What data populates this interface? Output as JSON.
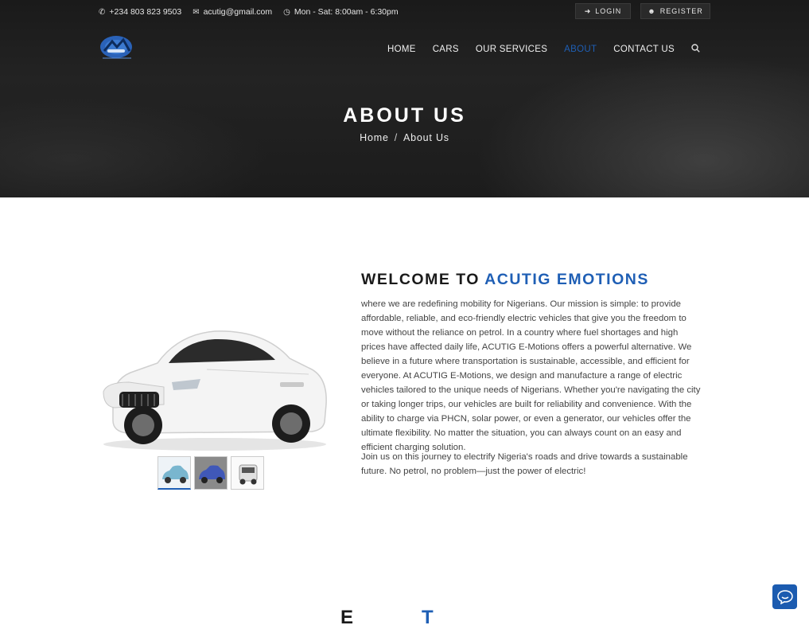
{
  "topbar": {
    "phone": "+234 803 823 9503",
    "email": "acutig@gmail.com",
    "hours": "Mon - Sat: 8:00am - 6:30pm",
    "login_label": "Login",
    "register_label": "Register"
  },
  "nav": {
    "items": [
      {
        "label": "Home",
        "active": false
      },
      {
        "label": "Cars",
        "active": false
      },
      {
        "label": "Our Services",
        "active": false
      },
      {
        "label": "About",
        "active": true
      },
      {
        "label": "Contact Us",
        "active": false
      }
    ],
    "search_icon": "search-icon"
  },
  "hero": {
    "title": "About Us",
    "breadcrumb": {
      "home": "Home",
      "current": "About Us"
    }
  },
  "about": {
    "welcome_prefix": "Welcome to",
    "welcome_brand": "Acutig Emotions",
    "paragraph1": "where we are redefining mobility for Nigerians. Our mission is simple: to provide affordable, reliable, and eco-friendly electric vehicles that give you the freedom to move without the reliance on petrol. In a country where fuel shortages and high prices have affected daily life, ACUTIG E-Motions offers a powerful alternative. We believe in a future where transportation is sustainable, accessible, and efficient for everyone. At ACUTIG E-Motions, we design and manufacture a range of electric vehicles tailored to the unique needs of Nigerians. Whether you're navigating the city or taking longer trips, our vehicles are built for reliability and convenience. With the ability to charge via PHCN, solar power, or even a generator, our vehicles offer the ultimate flexibility. No matter the situation, you can always count on an easy and efficient charging solution.",
    "paragraph2": "Join us on this journey to electrify Nigeria's roads and drive towards a sustainable future. No petrol, no problem—just the power of electric!"
  },
  "next_section": {
    "peek_left": "E",
    "peek_right": "T"
  },
  "colors": {
    "accent": "#1f5fb5",
    "hero_bg": "#1e1e1e"
  }
}
